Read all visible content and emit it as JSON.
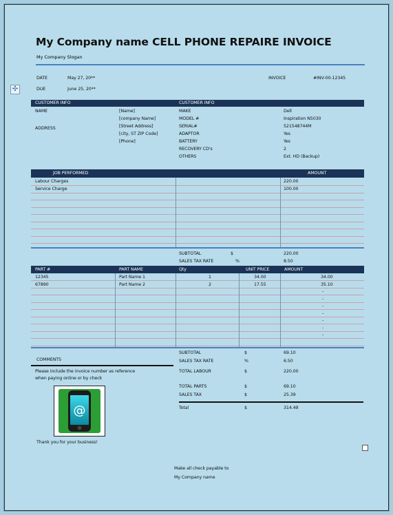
{
  "invoice": {
    "title": "My Company name CELL PHONE REPAIRE INVOICE",
    "slogan": "My Company Slogan",
    "date_label": "DATE",
    "date_value": "May 27, 20**",
    "due_label": "DUE",
    "due_value": "June 25, 20**",
    "invoice_label": "INVOICE",
    "invoice_value": "#INV-00-12345"
  },
  "customer": {
    "header_left": "CUSTOMER INFO",
    "header_right": "CUSTOMER INFO",
    "name_label": "NAME",
    "address_label": "ADDRESS",
    "values": [
      "[Name]",
      "[company Name]",
      "[Street Address]",
      "[city, ST ZIP Code]",
      "[Phone]"
    ],
    "device_labels": [
      "MAKE",
      "MODEL #",
      "SERIAL#",
      "ADAPTOR",
      "BATTERY",
      "RECOVERY CD's",
      "OTHERS"
    ],
    "device_values": [
      "Dell",
      "Inspiration N5030",
      "521548744M",
      "Yes",
      "Yes",
      "2",
      "Ext. HD (Backup)"
    ]
  },
  "jobs": {
    "header_job": "JOB PERFORMED",
    "header_amount": "AMOUNT",
    "items": [
      {
        "label": "Labour Charges",
        "amount": "220.00"
      },
      {
        "label": "Service Charge",
        "amount": "100.00"
      }
    ],
    "subtotal_label": "SUBTOTAL",
    "subtotal_currency": "$",
    "subtotal_value": "220.00",
    "tax_label": "SALES TAX RATE",
    "tax_pct": "%",
    "tax_value": "8.50"
  },
  "parts": {
    "headers": [
      "PART #",
      "PART NAME",
      "Qty",
      "UNIT PRICE",
      "AMOUNT"
    ],
    "items": [
      {
        "part_no": "12345",
        "name": "Part Name 1",
        "qty": "1",
        "unit": "34.00",
        "amount": "34.00"
      },
      {
        "part_no": "67890",
        "name": "Part Name 2",
        "qty": "2",
        "unit": "17.55",
        "amount": "35.10"
      }
    ],
    "empty_amount": "-"
  },
  "totals": {
    "subtotal_label": "SUBTOTAL",
    "subtotal_sym": "$",
    "subtotal_value": "69.10",
    "tax_rate_label": "SALES TAX RATE",
    "tax_rate_sym": "%",
    "tax_rate_value": "6.50",
    "labour_label": "TOTAL LABOUR",
    "labour_sym": "$",
    "labour_value": "220.00",
    "parts_label": "TOTAL PARTS",
    "parts_sym": "$",
    "parts_value": "69.10",
    "sales_tax_label": "SALES TAX",
    "sales_tax_sym": "$",
    "sales_tax_value": "25.39",
    "total_label": "Total",
    "total_sym": "$",
    "total_value": "314.49"
  },
  "comments": {
    "label": "COMMENTS",
    "line1": "Please include the invoice number as reference",
    "line2": "when paying online or by check",
    "thanks": "Thank you for your business!"
  },
  "footer": {
    "line1": "Make all check payable to",
    "line2": "My Company name"
  },
  "icons": {
    "logo": "phone-at-icon",
    "move": "move-handle-icon"
  },
  "colors": {
    "header_bar": "#1a3356",
    "accent_line": "#4a7fbf",
    "page_bg": "#b8dcec"
  }
}
